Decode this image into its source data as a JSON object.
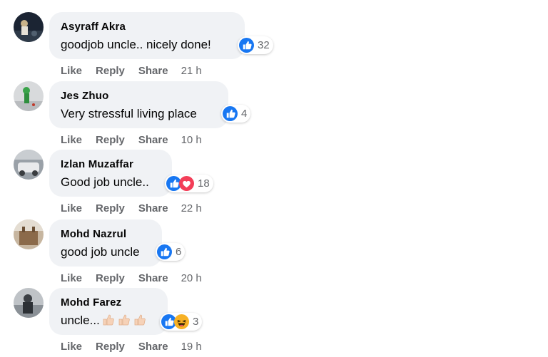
{
  "actions": {
    "like": "Like",
    "reply": "Reply",
    "share": "Share"
  },
  "comments": [
    {
      "author": "Asyraff Akra",
      "text": "goodjob uncle.. nicely done!",
      "reactions": [
        "like"
      ],
      "count": "32",
      "time": "21 h"
    },
    {
      "author": "Jes Zhuo",
      "text": "Very stressful living place",
      "reactions": [
        "like"
      ],
      "count": "4",
      "time": "10 h"
    },
    {
      "author": "Izlan Muzaffar",
      "text": "Good job uncle..",
      "reactions": [
        "like",
        "love"
      ],
      "count": "18",
      "time": "22 h"
    },
    {
      "author": "Mohd Nazrul",
      "text": "good job uncle",
      "reactions": [
        "like"
      ],
      "count": "6",
      "time": "20 h"
    },
    {
      "author": "Mohd Farez",
      "text": "uncle...",
      "text_emoji": "thumbs-up-light-skin-x3",
      "reactions": [
        "like",
        "haha"
      ],
      "count": "3",
      "time": "19 h"
    }
  ],
  "colors": {
    "bubble": "#f0f2f5",
    "like": "#1877f2",
    "love": "#f33e58",
    "haha": "#f7b125",
    "muted": "#65676b"
  }
}
